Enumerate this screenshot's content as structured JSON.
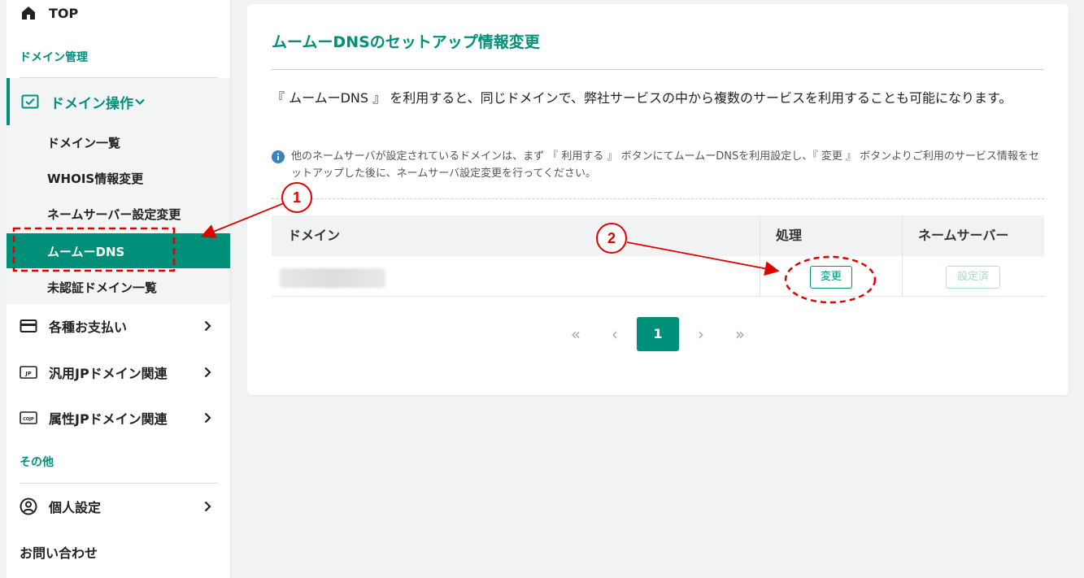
{
  "sidebar": {
    "top_label": "TOP",
    "section_domain": "ドメイン管理",
    "group_title": "ドメイン操作",
    "sub_items": [
      "ドメイン一覧",
      "WHOIS情報変更",
      "ネームサーバー設定変更",
      "ムームーDNS",
      "未認証ドメイン一覧"
    ],
    "payments": "各種お支払い",
    "jp_general": "汎用JPドメイン関連",
    "jp_attr": "属性JPドメイン関連",
    "jp_icon_text": "JP",
    "cojp_icon_text": "COJP",
    "section_other": "その他",
    "personal": "個人設定",
    "contact": "お問い合わせ"
  },
  "main": {
    "title": "ムームーDNSのセットアップ情報変更",
    "description": "『 ムームーDNS 』 を利用すると、同じドメインで、弊社サービスの中から複数のサービスを利用することも可能になります。",
    "note": "他のネームサーバが設定されているドメインは、まず 『 利用する 』 ボタンにてムームーDNSを利用設定し、『 変更 』 ボタンよりご利用のサービス情報をセットアップした後に、ネームサーバ設定変更を行ってください。",
    "table": {
      "headers": [
        "ドメイン",
        "処理",
        "ネームサーバー"
      ],
      "rows": [
        {
          "action_label": "変更",
          "ns_label": "設定済"
        }
      ]
    },
    "pagination": {
      "first": "«",
      "prev": "‹",
      "current": "1",
      "next": "›",
      "last": "»"
    }
  },
  "annotations": {
    "marker1": "1",
    "marker2": "2",
    "color": "#e00000"
  },
  "colors": {
    "accent": "#00907a"
  }
}
